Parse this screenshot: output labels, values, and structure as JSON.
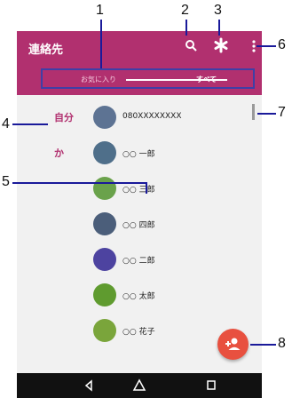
{
  "app_bar": {
    "title": "連絡先",
    "search_icon": "search-icon",
    "settings_icon": "asterisk-icon",
    "overflow_icon": "more-vert-icon"
  },
  "tabs": [
    {
      "label": "お気に入り"
    },
    {
      "label": "すべて",
      "active": true
    }
  ],
  "sections": [
    {
      "label": "自分"
    },
    {
      "label": "か"
    }
  ],
  "contacts": [
    {
      "name": "080XXXXXXXX",
      "avatar_color": "#5d7393"
    },
    {
      "name": "○○ 一郎",
      "avatar_color": "#4f6f8a"
    },
    {
      "name": "○○ 三郎",
      "avatar_color": "#6aa24b"
    },
    {
      "name": "○○ 四郎",
      "avatar_color": "#4b5e7a"
    },
    {
      "name": "○○ 二郎",
      "avatar_color": "#4d43a0"
    },
    {
      "name": "○○ 太郎",
      "avatar_color": "#5f9b2f"
    },
    {
      "name": "○○ 花子",
      "avatar_color": "#7aa53b"
    }
  ],
  "callouts": {
    "c1": "1",
    "c2": "2",
    "c3": "3",
    "c4": "4",
    "c5": "5",
    "c6": "6",
    "c7": "7",
    "c8": "8"
  },
  "fab": {
    "icon": "add-contact-icon"
  },
  "nav": {
    "back_icon": "back-triangle-icon",
    "home_icon": "home-icon",
    "recents_icon": "recents-square-icon"
  },
  "colors": {
    "accent": "#b1306f",
    "fab": "#e8503f",
    "callout_line": "#1a1a9a"
  }
}
